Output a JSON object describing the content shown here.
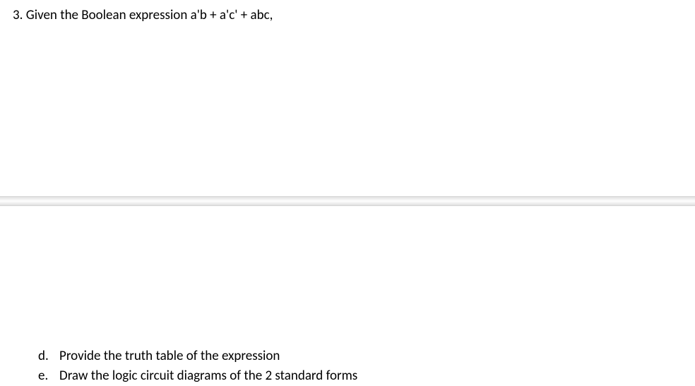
{
  "question": {
    "number": "3.",
    "prompt": "Given the Boolean expression a'b + a'c' + abc,"
  },
  "subitems": [
    {
      "letter": "d.",
      "text": "Provide the truth table of the expression"
    },
    {
      "letter": "e.",
      "text": "Draw the logic circuit diagrams of the 2 standard forms"
    }
  ]
}
